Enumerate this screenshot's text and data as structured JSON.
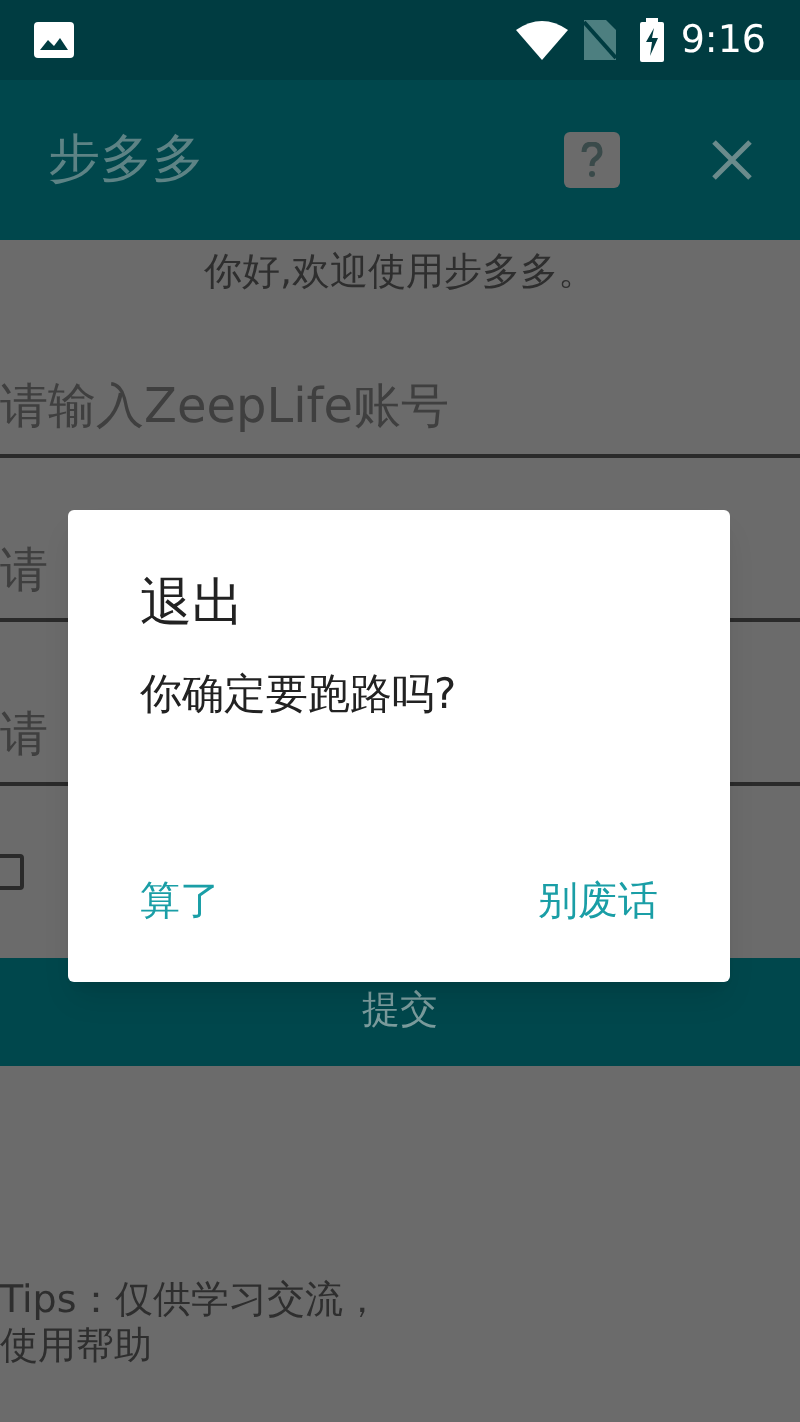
{
  "status_bar": {
    "time": "9:16"
  },
  "app_bar": {
    "title": "步多多"
  },
  "greeting": "你好,欢迎使用步多多。",
  "fields": [
    {
      "placeholder": "请输入ZeepLife账号"
    },
    {
      "placeholder": "请"
    },
    {
      "placeholder": "请"
    }
  ],
  "remember": {
    "checked": false
  },
  "submit_button": "提交",
  "tips": [
    "Tips：仅供学习交流，",
    "使用帮助"
  ],
  "dialog": {
    "title": "退出",
    "message": "你确定要跑路吗?",
    "buttons": [
      "算了",
      "别废话"
    ]
  }
}
